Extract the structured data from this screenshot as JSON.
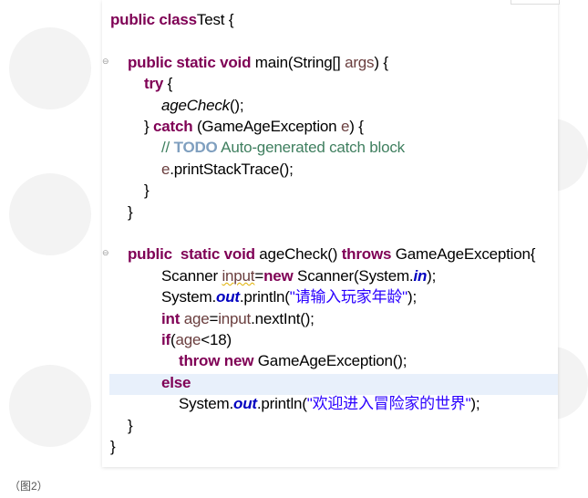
{
  "caption": "（图2）",
  "colors": {
    "keyword": "#7f0055",
    "variable": "#6a3e3e",
    "comment": "#3f7f5f",
    "todo": "#7f9fbf",
    "string": "#2a00ff",
    "static_field": "#0000c0",
    "highlight": "#e8f0fb"
  },
  "code_lines": [
    {
      "indent": 0,
      "tokens": [
        [
          "kw",
          "public class"
        ],
        [
          "",
          "Test {"
        ]
      ]
    },
    {
      "indent": 0,
      "tokens": []
    },
    {
      "indent": 1,
      "fold": true,
      "tokens": [
        [
          "kw",
          "public static void"
        ],
        [
          "",
          " main(String[] "
        ],
        [
          "var",
          "args"
        ],
        [
          "",
          ") {"
        ]
      ]
    },
    {
      "indent": 2,
      "tokens": [
        [
          "kw",
          "try"
        ],
        [
          "",
          " {"
        ]
      ]
    },
    {
      "indent": 3,
      "tokens": [
        [
          "it",
          "ageCheck"
        ],
        [
          "",
          "();"
        ]
      ]
    },
    {
      "indent": 2,
      "tokens": [
        [
          "",
          "} "
        ],
        [
          "kw",
          "catch"
        ],
        [
          "",
          " (GameAgeException "
        ],
        [
          "var",
          "e"
        ],
        [
          "",
          ") {"
        ]
      ]
    },
    {
      "indent": 3,
      "tokens": [
        [
          "cm",
          "// "
        ],
        [
          "todo",
          "TODO"
        ],
        [
          "cm",
          " Auto-generated catch block"
        ]
      ]
    },
    {
      "indent": 3,
      "tokens": [
        [
          "var",
          "e"
        ],
        [
          "",
          ".printStackTrace();"
        ]
      ]
    },
    {
      "indent": 2,
      "tokens": [
        [
          "",
          "}"
        ]
      ]
    },
    {
      "indent": 1,
      "tokens": [
        [
          "",
          "}"
        ]
      ]
    },
    {
      "indent": 1,
      "tokens": []
    },
    {
      "indent": 1,
      "fold": true,
      "tokens": [
        [
          "kw",
          "public  static void"
        ],
        [
          "",
          " ageCheck() "
        ],
        [
          "kw",
          "throws"
        ],
        [
          "",
          " GameAgeException{"
        ]
      ]
    },
    {
      "indent": 3,
      "tokens": [
        [
          "",
          "Scanner "
        ],
        [
          "var warn",
          "input"
        ],
        [
          "",
          "="
        ],
        [
          "kw",
          "new"
        ],
        [
          "",
          " Scanner(System."
        ],
        [
          "sf",
          "in"
        ],
        [
          "",
          ");"
        ]
      ]
    },
    {
      "indent": 3,
      "tokens": [
        [
          "",
          "System."
        ],
        [
          "sf",
          "out"
        ],
        [
          "",
          ".println("
        ],
        [
          "str",
          "\"请输入玩家年龄\""
        ],
        [
          "",
          ");"
        ]
      ]
    },
    {
      "indent": 3,
      "tokens": [
        [
          "kw",
          "int"
        ],
        [
          "var",
          " age"
        ],
        [
          "",
          "="
        ],
        [
          "var",
          "input"
        ],
        [
          "",
          ".nextInt();"
        ]
      ]
    },
    {
      "indent": 3,
      "tokens": [
        [
          "kw",
          "if"
        ],
        [
          "",
          "("
        ],
        [
          "var",
          "age"
        ],
        [
          "",
          "<18)"
        ]
      ]
    },
    {
      "indent": 4,
      "tokens": [
        [
          "kw",
          "throw new"
        ],
        [
          "",
          " GameAgeException();"
        ]
      ]
    },
    {
      "indent": 3,
      "highlight": true,
      "tokens": [
        [
          "kw",
          "else"
        ]
      ]
    },
    {
      "indent": 4,
      "tokens": [
        [
          "",
          "System."
        ],
        [
          "sf",
          "out"
        ],
        [
          "",
          ".println("
        ],
        [
          "str",
          "\"欢迎进入冒险家的世界\""
        ],
        [
          "",
          ");"
        ]
      ]
    },
    {
      "indent": 1,
      "tokens": [
        [
          "",
          "}"
        ]
      ]
    },
    {
      "indent": 0,
      "tokens": [
        [
          "",
          "}"
        ]
      ]
    }
  ]
}
